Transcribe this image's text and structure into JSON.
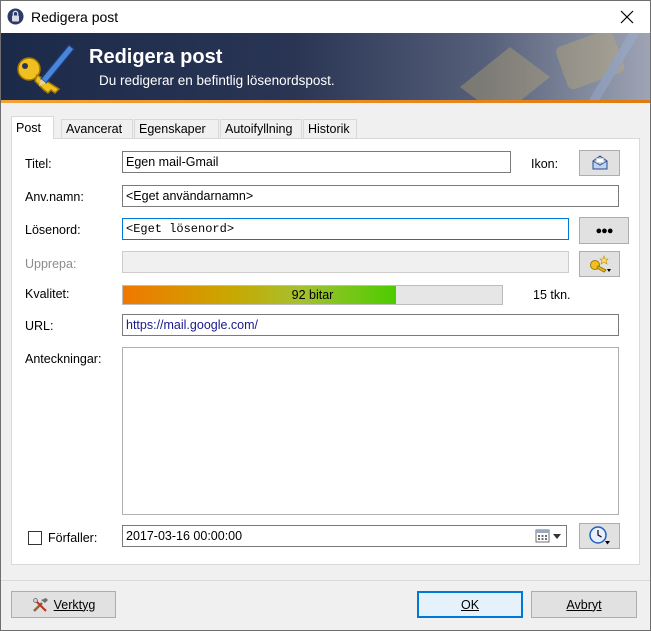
{
  "window": {
    "title": "Redigera post"
  },
  "banner": {
    "title": "Redigera post",
    "subtitle": "Du redigerar en befintlig lösenordspost."
  },
  "tabs": [
    {
      "label": "Post",
      "active": true
    },
    {
      "label": "Avancerat",
      "active": false
    },
    {
      "label": "Egenskaper",
      "active": false
    },
    {
      "label": "Autoifyllning",
      "active": false
    },
    {
      "label": "Historik",
      "active": false
    }
  ],
  "form": {
    "title_label": "Titel:",
    "title_value": "Egen mail-Gmail",
    "icon_label": "Ikon:",
    "username_label": "Anv.namn:",
    "username_value": "<Eget användarnamn>",
    "password_label": "Lösenord:",
    "password_value": "<Eget lösenord>",
    "password_toggle_label": "●●●",
    "repeat_label": "Upprepa:",
    "repeat_value": "",
    "quality_label": "Kvalitet:",
    "quality_text": "92 bitar",
    "quality_fraction": 0.72,
    "quality_count": "15 tkn.",
    "url_label": "URL:",
    "url_value": "https://mail.google.com/",
    "notes_label": "Anteckningar:",
    "notes_value": "",
    "expires_label": "Förfaller:",
    "expires_checked": false,
    "expires_value": "2017-03-16 00:00:00"
  },
  "footer": {
    "tools_label": "Verktyg",
    "ok_label": "OK",
    "cancel_label": "Avbryt"
  },
  "colors": {
    "banner_dark": "#1c2a4a",
    "accent_orange": "#f2a23a",
    "focus_blue": "#0078d7",
    "quality_start": "#f07800",
    "quality_end": "#4ccc00"
  }
}
